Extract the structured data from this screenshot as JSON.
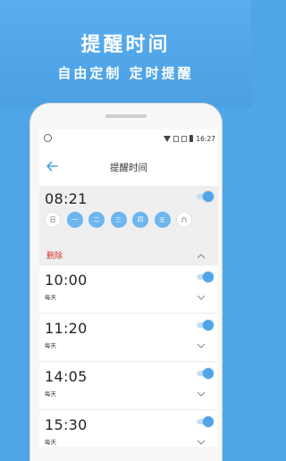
{
  "promo": {
    "title": "提醒时间",
    "subtitle": "自由定制  定时提醒"
  },
  "statusbar": {
    "time": "16:27"
  },
  "appbar": {
    "title": "提醒时间"
  },
  "expanded_alarm": {
    "time": "08:21",
    "enabled": true,
    "days": [
      {
        "label": "日",
        "selected": false
      },
      {
        "label": "一",
        "selected": true
      },
      {
        "label": "二",
        "selected": true
      },
      {
        "label": "三",
        "selected": true
      },
      {
        "label": "四",
        "selected": true
      },
      {
        "label": "五",
        "selected": true
      },
      {
        "label": "六",
        "selected": false
      }
    ],
    "delete_label": "删除"
  },
  "alarms": [
    {
      "time": "10:00",
      "repeat": "每天",
      "enabled": true
    },
    {
      "time": "11:20",
      "repeat": "每天",
      "enabled": true
    },
    {
      "time": "14:05",
      "repeat": "每天",
      "enabled": true
    },
    {
      "time": "15:30",
      "repeat": "每天",
      "enabled": true
    }
  ],
  "colors": {
    "background": "#4fa6e6",
    "accent": "#4ea5ea",
    "day_selected": "#6db6ef",
    "delete": "#d0352a"
  }
}
